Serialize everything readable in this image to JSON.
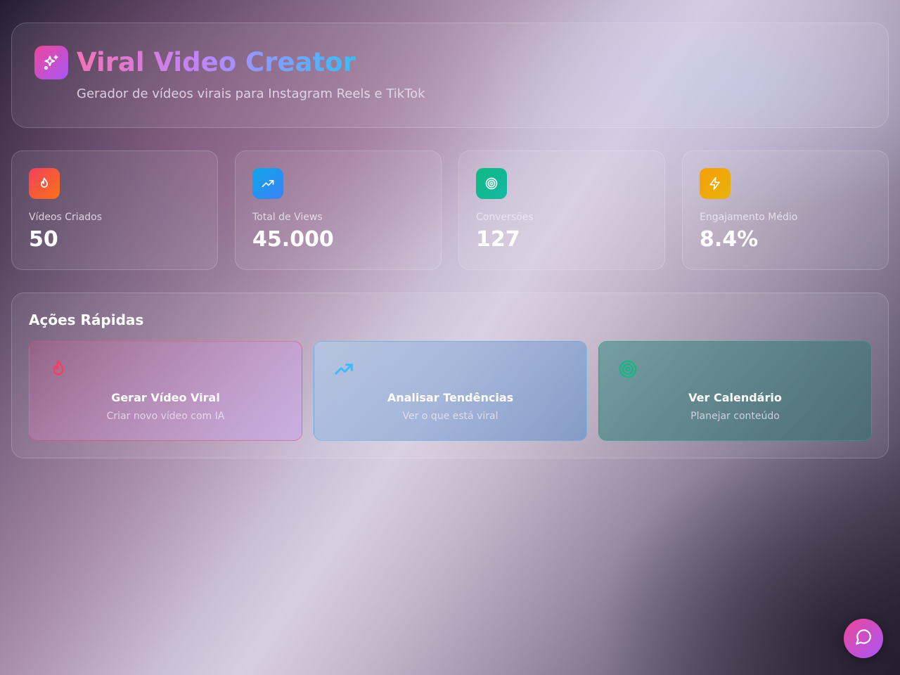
{
  "header": {
    "title": "Viral Video Creator",
    "subtitle": "Gerador de vídeos virais para Instagram Reels e TikTok",
    "logo_icon": "sparkles-icon"
  },
  "stats": [
    {
      "label": "Vídeos Criados",
      "value": "50",
      "icon": "flame-icon",
      "color": "#f43f5e"
    },
    {
      "label": "Total de Views",
      "value": "45.000",
      "icon": "trending-up-icon",
      "color": "#0ea5e9"
    },
    {
      "label": "Conversões",
      "value": "127",
      "icon": "target-icon",
      "color": "#10b981"
    },
    {
      "label": "Engajamento Médio",
      "value": "8.4%",
      "icon": "zap-icon",
      "color": "#f59e0b"
    }
  ],
  "quick_actions": {
    "title": "Ações Rápidas",
    "items": [
      {
        "title": "Gerar Vídeo Viral",
        "subtitle": "Criar novo vídeo com IA",
        "icon": "flame-icon",
        "color": "#f43f5e"
      },
      {
        "title": "Analisar Tendências",
        "subtitle": "Ver o que está viral",
        "icon": "trending-up-icon",
        "color": "#38bdf8"
      },
      {
        "title": "Ver Calendário",
        "subtitle": "Planejar conteúdo",
        "icon": "target-icon",
        "color": "#10b981"
      }
    ]
  },
  "chat_button": {
    "icon": "message-circle-icon"
  }
}
